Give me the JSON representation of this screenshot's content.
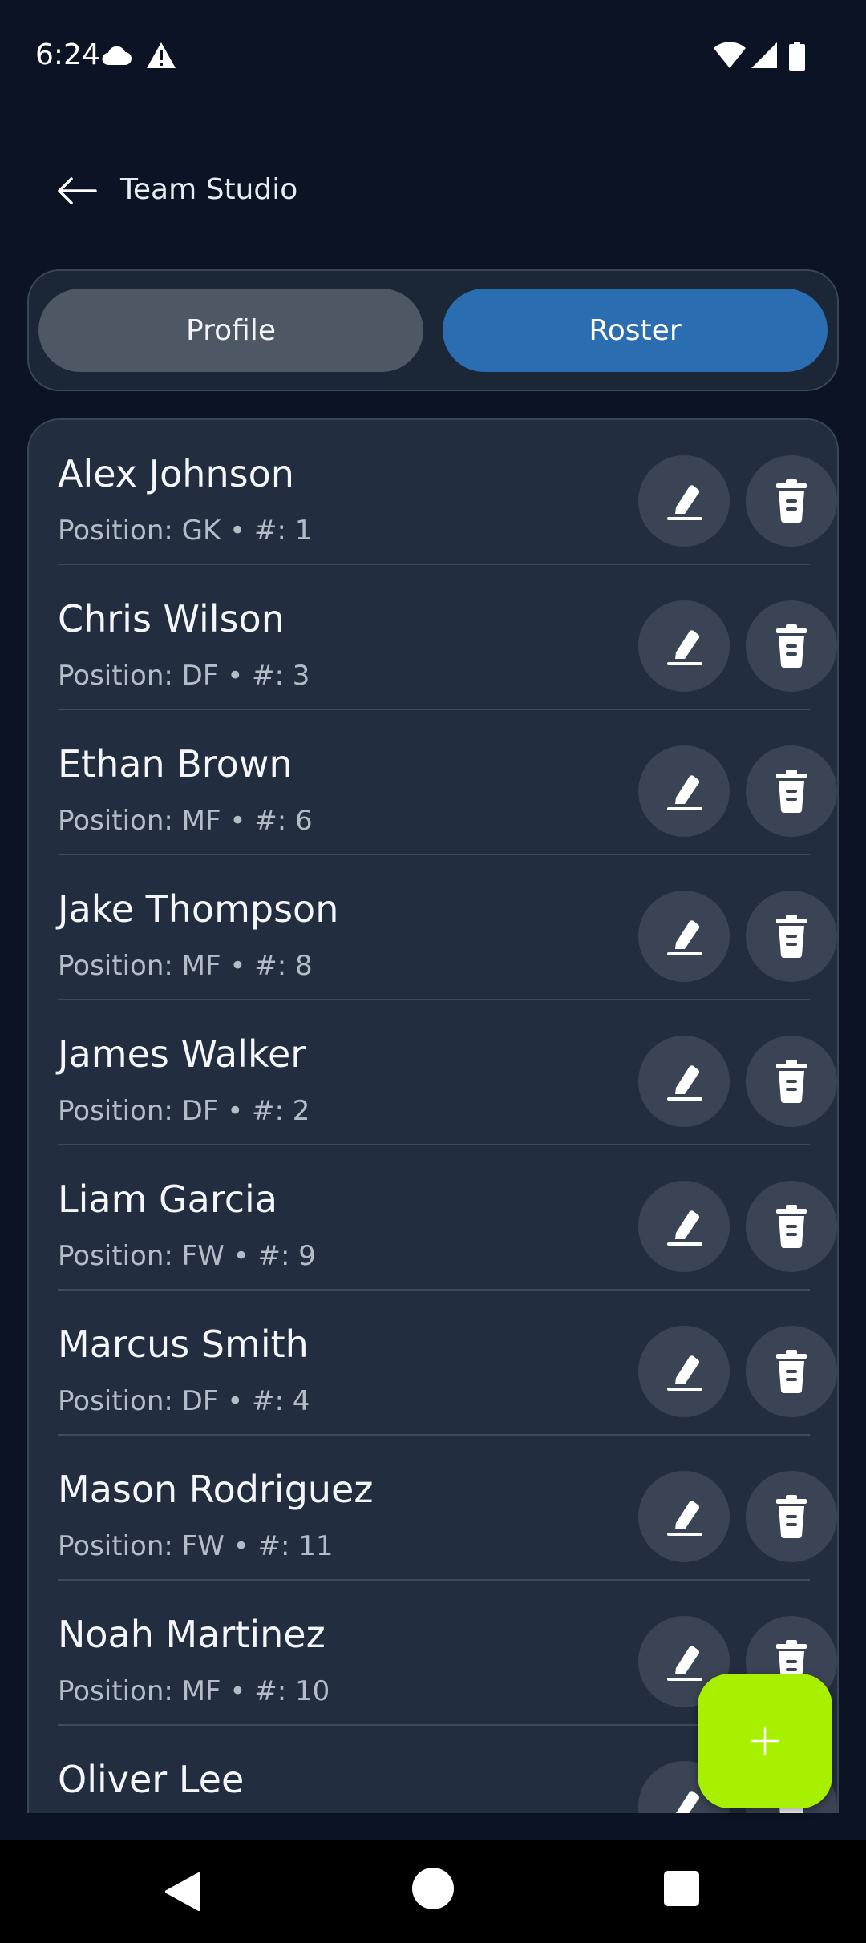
{
  "status_bar": {
    "time": "6:24",
    "icons": [
      "cloud-icon",
      "alert-icon",
      "wifi-icon",
      "signal-icon",
      "battery-icon"
    ]
  },
  "app_bar": {
    "title": "Team Studio",
    "back_icon": "arrow-left-icon"
  },
  "tabs": {
    "profile_label": "Profile",
    "roster_label": "Roster",
    "selected": "Roster"
  },
  "roster": {
    "players": [
      {
        "name": "Alex Johnson",
        "meta": "Position: GK • #: 1"
      },
      {
        "name": "Chris Wilson",
        "meta": "Position: DF • #: 3"
      },
      {
        "name": "Ethan Brown",
        "meta": "Position: MF • #: 6"
      },
      {
        "name": "Jake Thompson",
        "meta": "Position: MF • #: 8"
      },
      {
        "name": "James Walker",
        "meta": "Position: DF • #: 2"
      },
      {
        "name": "Liam Garcia",
        "meta": "Position: FW • #: 9"
      },
      {
        "name": "Marcus Smith",
        "meta": "Position: DF • #: 4"
      },
      {
        "name": "Mason Rodriguez",
        "meta": "Position: FW • #: 11"
      },
      {
        "name": "Noah Martinez",
        "meta": "Position: MF • #: 10"
      },
      {
        "name": "Oliver Lee",
        "meta": ""
      }
    ],
    "row_actions": [
      "edit-icon",
      "delete-icon"
    ]
  },
  "fab": {
    "icon": "plus-icon",
    "color": "#a6f000"
  },
  "colors": {
    "background": "#0b1324",
    "card": "#222d3f",
    "accent_tab": "#2a6db0",
    "inactive_tab": "#4e5764",
    "fab": "#a6f000"
  },
  "nav_bar": {
    "icons": [
      "nav-back-icon",
      "nav-home-icon",
      "nav-recents-icon"
    ]
  }
}
